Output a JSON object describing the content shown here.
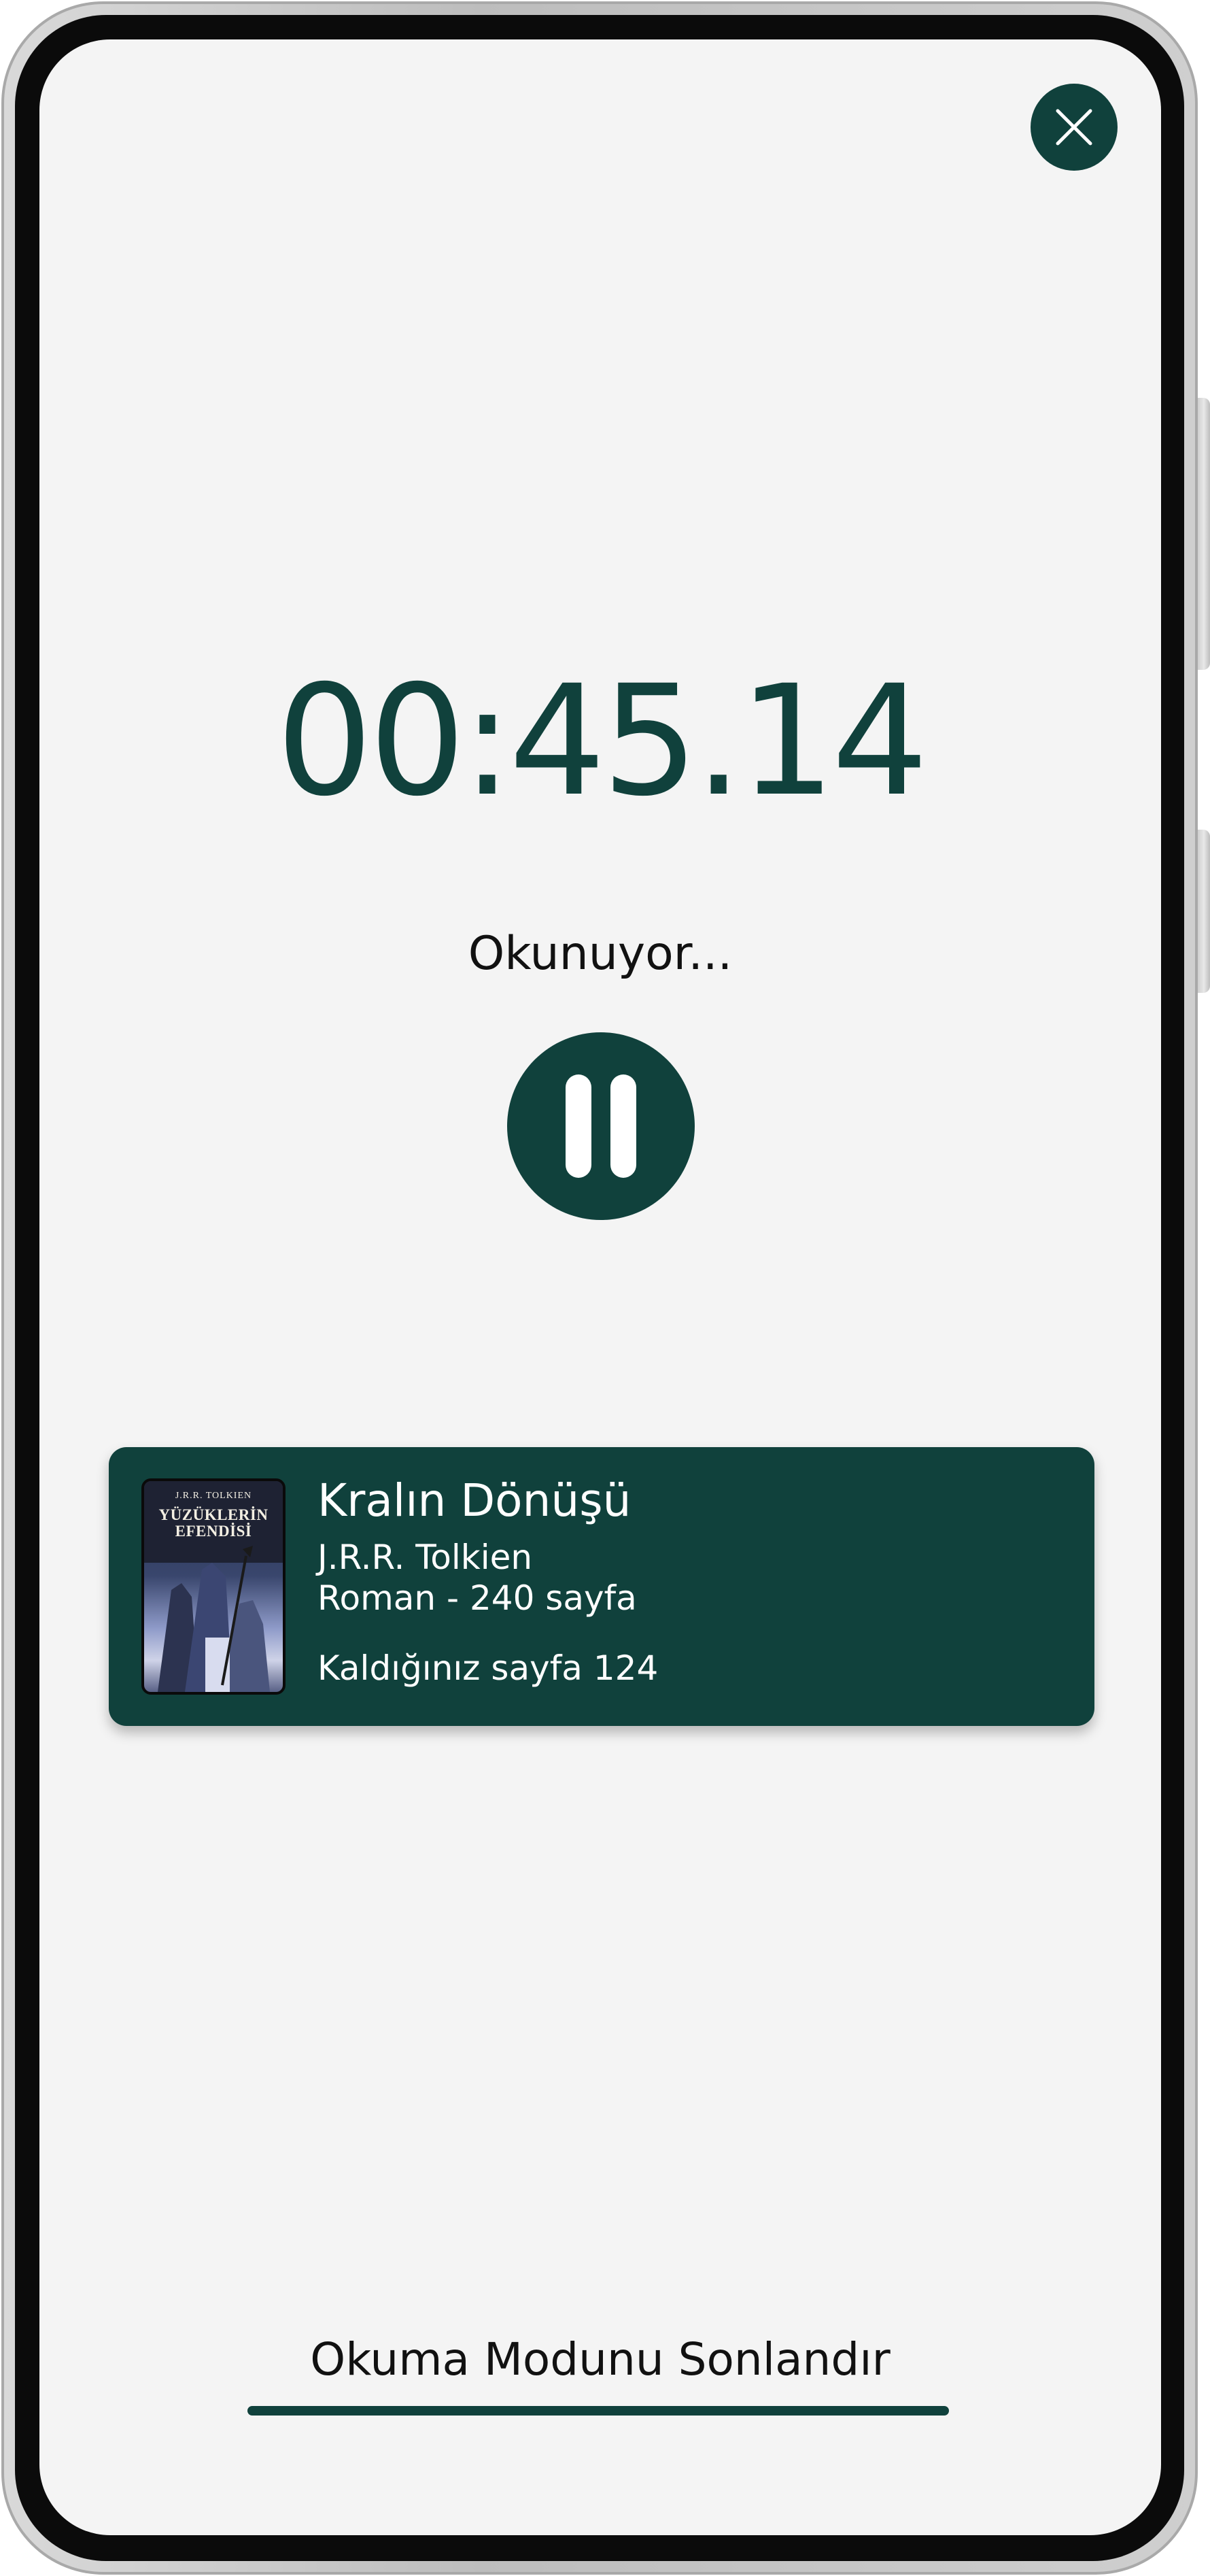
{
  "colors": {
    "accent": "#10413c",
    "screen_background": "#f4f4f4",
    "text_dark": "#111111",
    "text_light": "#ffffff"
  },
  "header": {
    "close_icon": "close-icon"
  },
  "timer": {
    "elapsed": "00:45.14",
    "status": "Okunuyor..."
  },
  "controls": {
    "pause_icon": "pause-icon"
  },
  "book": {
    "cover_icon": "book-cover-image",
    "cover_author": "J.R.R. TOLKIEN",
    "cover_title_line1": "YÜZÜKLERİN",
    "cover_title_line2": "EFENDİSİ",
    "title": "Kralın Dönüşü",
    "author": "J.R.R. Tolkien",
    "meta": "Roman - 240 sayfa",
    "current_page": "Kaldığınız sayfa 124"
  },
  "footer": {
    "end_mode_label": "Okuma Modunu Sonlandır"
  }
}
